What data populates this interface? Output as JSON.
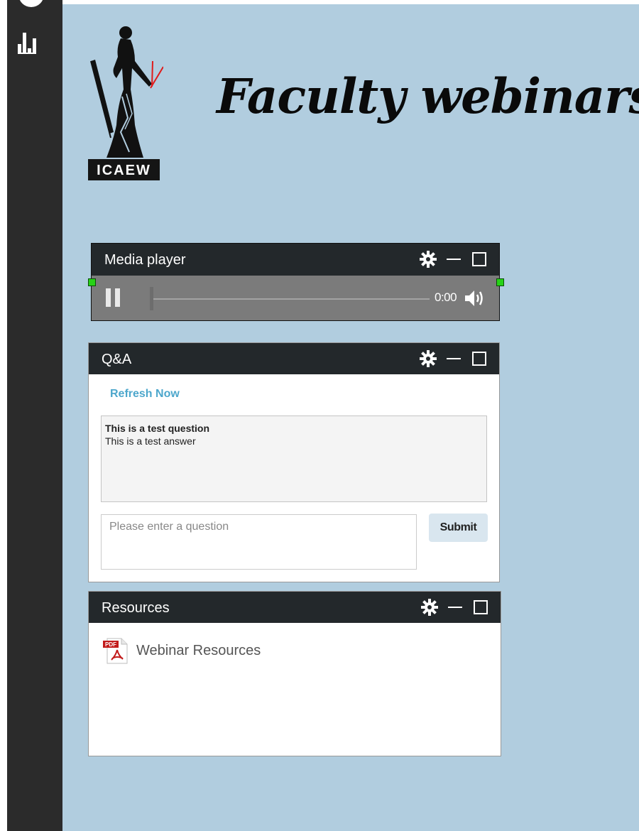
{
  "sidebar": {
    "icons": [
      "circle-icon",
      "bar-chart-icon"
    ]
  },
  "branding": {
    "logo_text": "ICAEW",
    "title": "Faculty webinars"
  },
  "media_player": {
    "title": "Media player",
    "time": "0:00",
    "state": "paused",
    "progress": 0
  },
  "qa": {
    "title": "Q&A",
    "refresh_label": "Refresh Now",
    "items": [
      {
        "question": "This is a test question",
        "answer": "This is a test answer"
      }
    ],
    "input_placeholder": "Please enter a question",
    "input_value": "",
    "submit_label": "Submit"
  },
  "resources": {
    "title": "Resources",
    "items": [
      {
        "label": "Webinar Resources",
        "icon": "pdf-icon",
        "icon_badge": "PDF"
      }
    ]
  },
  "panel_controls": [
    "gear-icon",
    "minimize-icon",
    "maximize-icon"
  ],
  "colors": {
    "stage": "#b1cddf",
    "sidebar": "#2b2b2b",
    "panel_header": "#23282b",
    "link": "#4da7cc",
    "pdf_red": "#c21b1b"
  }
}
